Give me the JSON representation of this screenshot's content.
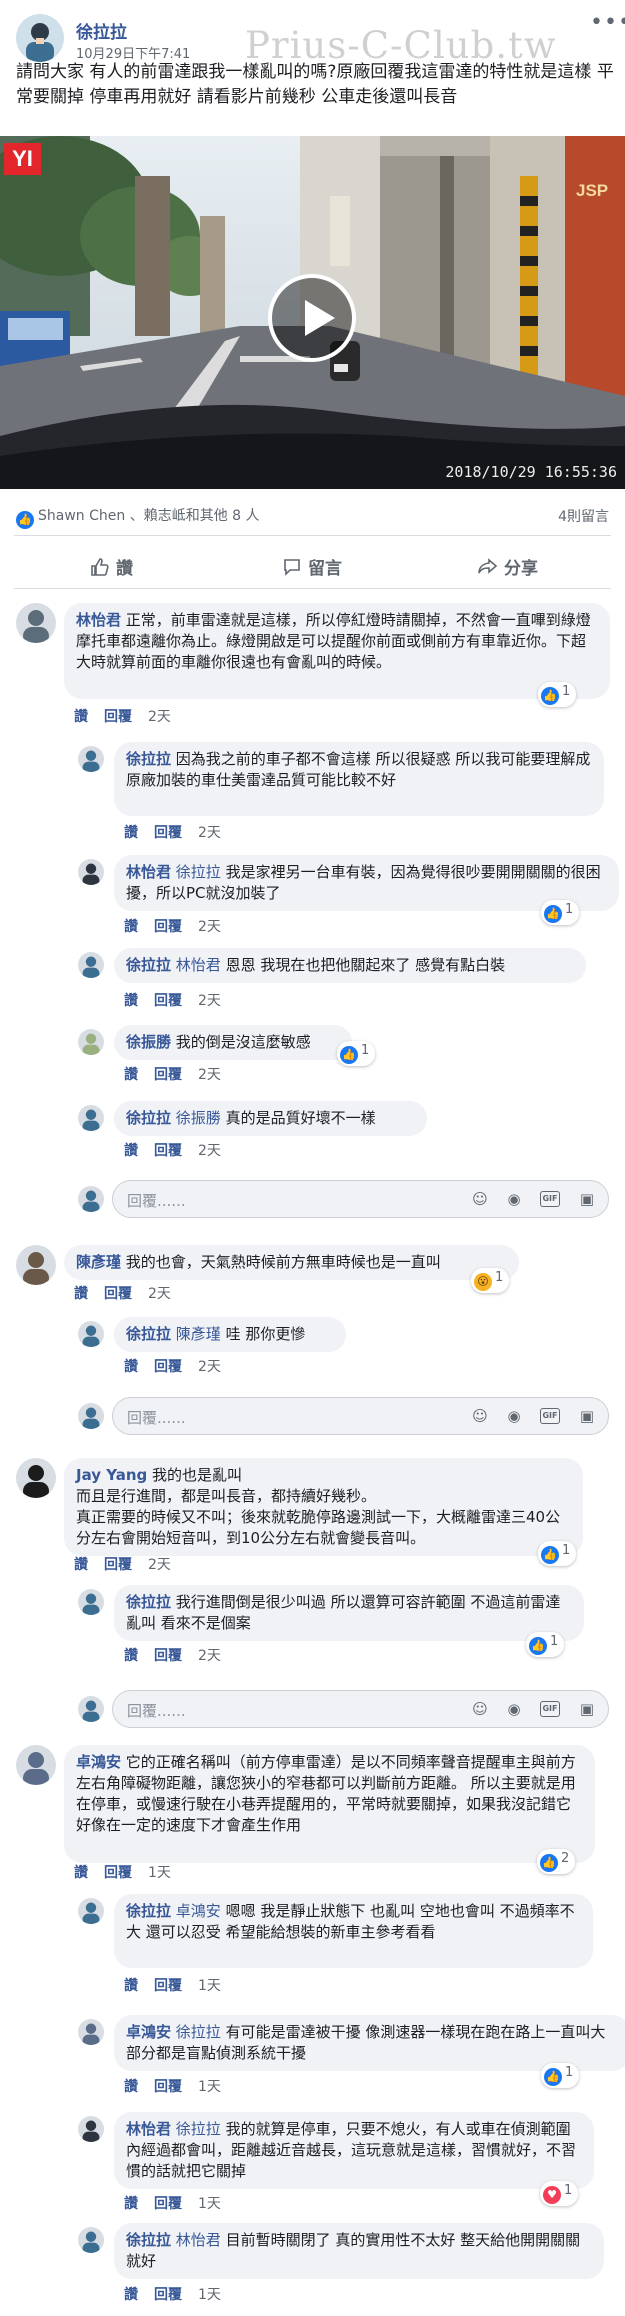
{
  "post": {
    "author": "徐拉拉",
    "time": "10月29日下午7:41",
    "more": "•••",
    "watermark": "Prius-C-Club.tw",
    "text": "請問大家 有人的前雷達跟我一樣亂叫的嗎?原廠回覆我這雷達的特性就是這樣 平常要關掉 停車再用就好 請看影片前幾秒 公車走後還叫長音",
    "video": {
      "brand": "YI",
      "timestamp": "2018/10/29 16:55:36"
    },
    "likes_text": "Shawn Chen 、賴志岻和其他 8 人",
    "comment_count": "4則留言"
  },
  "actions": {
    "like": "讚",
    "comment": "留言",
    "share": "分享"
  },
  "labels": {
    "like": "讚",
    "reply": "回覆",
    "reply_placeholder": "回覆......"
  },
  "comments": [
    {
      "author": "林怡君",
      "text": "正常，前車雷達就是這樣，所以停紅燈時請關掉，不然會一直嗶到綠燈摩托車都遠離你為止。綠燈開啟是可以提醒你前面或側前方有車靠近你。下超大時就算前面的車離你很遠也有會亂叫的時候。",
      "time": "2天",
      "reaction": "1"
    },
    {
      "author": "徐拉拉",
      "text": "因為我之前的車子都不會這樣 所以很疑惑 所以我可能要理解成 原廠加裝的車仕美雷達品質可能比較不好",
      "time": "2天"
    },
    {
      "author": "林怡君",
      "tag": "徐拉拉",
      "text": "我是家裡另一台車有裝，因為覺得很吵要開開關關的很困擾，所以PC就沒加裝了",
      "time": "2天",
      "reaction": "1"
    },
    {
      "author": "徐拉拉",
      "tag": "林怡君",
      "text": "恩恩 我現在也把他關起來了 感覺有點白裝",
      "time": "2天"
    },
    {
      "author": "徐振勝",
      "text": "我的倒是沒這麼敏感",
      "time": "2天",
      "reaction": "1"
    },
    {
      "author": "徐拉拉",
      "tag": "徐振勝",
      "text": "真的是品質好壞不一樣",
      "time": "2天"
    },
    {
      "author": "陳彥瑾",
      "text": "我的也會，天氣熱時候前方無車時候也是一直叫",
      "time": "2天",
      "reaction": "1"
    },
    {
      "author": "徐拉拉",
      "tag": "陳彥瑾",
      "text": "哇 那你更慘",
      "time": "2天"
    },
    {
      "author": "Jay Yang",
      "text": "我的也是亂叫\n而且是行進間，都是叫長音，都持續好幾秒。\n真正需要的時候又不叫；後來就乾脆停路邊測試一下，大概離雷達三40公分左右會開始短音叫，到10公分左右就會變長音叫。",
      "time": "2天",
      "reaction": "1"
    },
    {
      "author": "徐拉拉",
      "text": "我行進間倒是很少叫過 所以還算可容許範圍 不過這前雷達亂叫 看來不是個案",
      "time": "2天",
      "reaction": "1"
    },
    {
      "author": "卓鴻安",
      "text": "它的正確名稱叫（前方停車雷達）是以不同頻率聲音提醒車主與前方左右角障礙物距離，讓您狹小的窄巷都可以判斷前方距離。 所以主要就是用在停車，或慢速行駛在小巷弄提醒用的，平常時就要關掉，如果我沒記錯它好像在一定的速度下才會產生作用",
      "time": "1天",
      "reaction": "2"
    },
    {
      "author": "徐拉拉",
      "tag": "卓鴻安",
      "text": "嗯嗯 我是靜止狀態下 也亂叫 空地也會叫 不過頻率不大 還可以忍受 希望能給想裝的新車主參考看看",
      "time": "1天"
    },
    {
      "author": "卓鴻安",
      "tag": "徐拉拉",
      "text": "有可能是雷達被干擾 像測速器一樣現在跑在路上一直叫大部分都是盲點偵測系統干擾",
      "time": "1天",
      "reaction": "1"
    },
    {
      "author": "林怡君",
      "tag": "徐拉拉",
      "text": "我的就算是停車，只要不熄火，有人或車在偵測範圍內經過都會叫，距離越近音越長，這玩意就是這樣，習慣就好，不習慣的話就把它關掉",
      "time": "1天",
      "reaction": "1"
    },
    {
      "author": "徐拉拉",
      "tag": "林怡君",
      "text": "目前暫時關閉了 真的實用性不太好 整天給他開開關關就好",
      "time": "1天"
    }
  ],
  "colors": {
    "link": "#385898",
    "accent": "#1877f2",
    "bubble": "#f0f2f5"
  },
  "icons": [
    "like-icon",
    "comment-icon",
    "share-icon",
    "smiley-icon",
    "camera-icon",
    "gif-icon",
    "sticker-icon",
    "play-icon"
  ]
}
